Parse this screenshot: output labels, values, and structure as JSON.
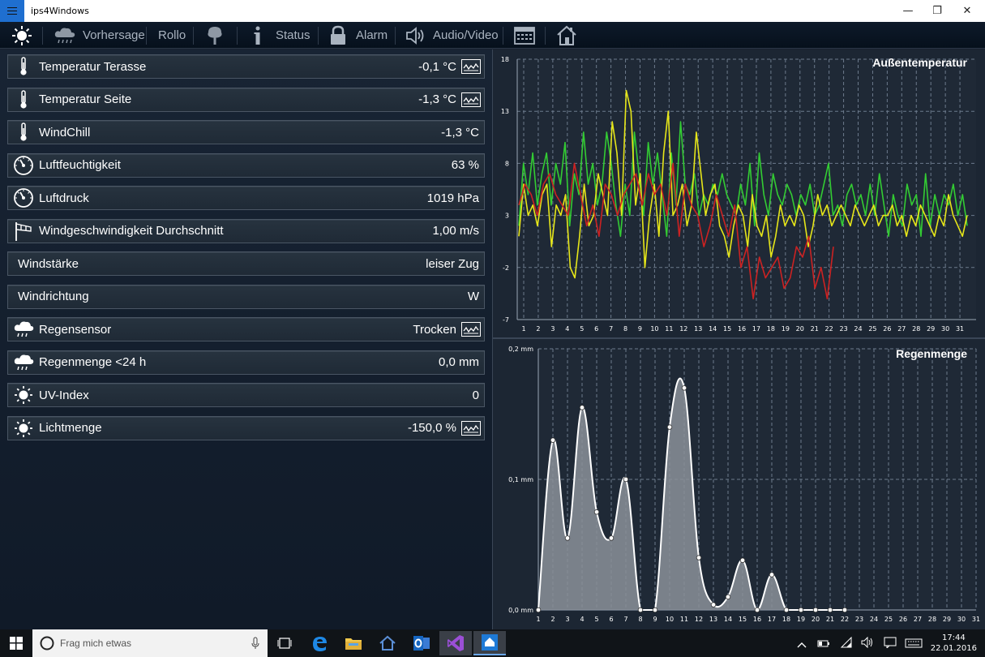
{
  "app": {
    "title": "ips4Windows"
  },
  "window_controls": {
    "minimize": "—",
    "maximize": "❐",
    "close": "✕"
  },
  "nav": {
    "items": [
      {
        "label": ""
      },
      {
        "label": "Vorhersage"
      },
      {
        "label": "Rollo"
      },
      {
        "label": ""
      },
      {
        "label": "Status"
      },
      {
        "label": "Alarm"
      },
      {
        "label": "Audio/Video"
      },
      {
        "label": ""
      },
      {
        "label": ""
      }
    ]
  },
  "sensors": [
    {
      "label": "Temperatur Terasse",
      "value": "-0,1 °C",
      "icon": "thermometer-icon",
      "chart": true
    },
    {
      "label": "Temperatur Seite",
      "value": "-1,3 °C",
      "icon": "thermometer-icon",
      "chart": true
    },
    {
      "label": "WindChill",
      "value": "-1,3 °C",
      "icon": "thermometer-icon",
      "chart": false
    },
    {
      "label": "Luftfeuchtigkeit",
      "value": "63 %",
      "icon": "gauge-icon",
      "chart": false
    },
    {
      "label": "Luftdruck",
      "value": "1019 hPa",
      "icon": "gauge-icon",
      "chart": false
    },
    {
      "label": "Windgeschwindigkeit Durchschnitt",
      "value": "1,00 m/s",
      "icon": "windsock-icon",
      "chart": false
    },
    {
      "label": "Windstärke",
      "value": "leiser Zug",
      "icon": "",
      "chart": false
    },
    {
      "label": "Windrichtung",
      "value": "W",
      "icon": "",
      "chart": false
    },
    {
      "label": "Regensensor",
      "value": "Trocken",
      "icon": "rain-cloud-icon",
      "chart": true
    },
    {
      "label": "Regenmenge <24 h",
      "value": "0,0 mm",
      "icon": "rain-cloud-icon",
      "chart": false
    },
    {
      "label": "UV-Index",
      "value": "0",
      "icon": "sun-icon",
      "chart": false
    },
    {
      "label": "Lichtmenge",
      "value": "-150,0 %",
      "icon": "sun-icon",
      "chart": true
    }
  ],
  "colors": {
    "green": "#33cc33",
    "yellow": "#e6e619",
    "red": "#cc2222",
    "grid": "#6c7a8c",
    "rain_fill": "#8b9099"
  },
  "chart_temp": {
    "type": "line",
    "title": "Außentemperatur",
    "y_ticks": [
      "18",
      "13",
      "8",
      "3",
      "-2",
      "-7"
    ],
    "x_ticks": [
      "1",
      "2",
      "3",
      "4",
      "5",
      "6",
      "7",
      "8",
      "9",
      "10",
      "11",
      "12",
      "13",
      "14",
      "15",
      "16",
      "17",
      "18",
      "19",
      "20",
      "21",
      "22",
      "23",
      "24",
      "25",
      "26",
      "27",
      "28",
      "29",
      "30",
      "31"
    ],
    "ylim": [
      -7,
      18
    ],
    "series": [
      {
        "color": "#33cc33",
        "values": [
          2,
          8,
          5,
          9,
          4,
          7,
          9,
          4,
          8,
          6,
          10,
          2,
          7,
          5,
          11,
          6,
          8,
          4,
          6,
          11,
          8,
          4,
          1,
          6,
          3,
          11,
          7,
          3,
          10,
          6,
          9,
          5,
          1,
          9,
          4,
          12,
          6,
          5,
          7,
          3,
          5,
          4,
          6,
          5,
          7,
          5,
          4,
          3,
          6,
          4,
          8,
          2,
          9,
          5,
          3,
          7,
          5,
          4,
          6,
          5,
          3,
          5,
          4,
          6,
          3,
          4,
          6,
          8,
          3,
          4,
          2,
          5,
          6,
          4,
          5,
          3,
          6,
          3,
          7,
          4,
          1,
          5,
          3,
          2,
          6,
          4,
          5,
          1,
          7,
          2,
          5,
          3,
          5,
          4,
          6,
          3,
          5,
          2
        ]
      },
      {
        "color": "#e6e619",
        "values": [
          1,
          6,
          3,
          4,
          2,
          5,
          6,
          0,
          4,
          3,
          5,
          -2,
          -3,
          1,
          6,
          2,
          3,
          7,
          5,
          3,
          12,
          9,
          3,
          15,
          13,
          4,
          7,
          -2,
          3,
          6,
          1,
          9,
          13,
          3,
          4,
          6,
          2,
          4,
          11,
          7,
          3,
          5,
          6,
          2,
          1,
          -1,
          2,
          4,
          3,
          0,
          5,
          2,
          1,
          3,
          -1,
          1,
          4,
          2,
          3,
          2,
          4,
          3,
          0,
          2,
          5,
          3,
          4,
          2,
          3,
          4,
          3,
          2,
          4,
          3,
          2,
          3,
          4,
          2,
          3,
          3,
          4,
          2,
          3,
          1,
          3,
          2,
          4,
          3,
          2,
          1,
          3,
          2,
          5,
          3,
          2,
          1,
          3
        ]
      },
      {
        "color": "#cc2222",
        "values": [
          4,
          6,
          5,
          3,
          6,
          7,
          5,
          4,
          3,
          8,
          5,
          2,
          4,
          1,
          6,
          5,
          3,
          5,
          6,
          7,
          4,
          7,
          5,
          6,
          3,
          8,
          1,
          6,
          4,
          3,
          0,
          2,
          5,
          3,
          1,
          4,
          -2,
          0,
          -5,
          -1,
          -3,
          -2,
          -1,
          -4,
          -3,
          0,
          -1,
          1,
          -4,
          -2,
          -5,
          0
        ]
      }
    ]
  },
  "chart_rain": {
    "type": "area",
    "title": "Regenmenge",
    "y_ticks": [
      "0,2 mm",
      "0,1 mm",
      "0,0 mm"
    ],
    "x_ticks": [
      "1",
      "2",
      "3",
      "4",
      "5",
      "6",
      "7",
      "8",
      "9",
      "10",
      "11",
      "12",
      "13",
      "14",
      "15",
      "16",
      "17",
      "18",
      "19",
      "20",
      "21",
      "22",
      "23",
      "24",
      "25",
      "26",
      "27",
      "28",
      "29",
      "30",
      "31"
    ],
    "ylim": [
      0,
      0.2
    ],
    "x": [
      1,
      2,
      3,
      4,
      5,
      6,
      7,
      8,
      9,
      10,
      11,
      12,
      13,
      14,
      15,
      16,
      17,
      18,
      19,
      20,
      21,
      22
    ],
    "values": [
      0,
      0.13,
      0.055,
      0.155,
      0.075,
      0.055,
      0.1,
      0,
      0,
      0.14,
      0.17,
      0.04,
      0.004,
      0.01,
      0.038,
      0,
      0.027,
      0,
      0,
      0,
      0,
      0
    ]
  },
  "taskbar": {
    "search_placeholder": "Frag mich etwas",
    "time": "17:44",
    "date": "22.01.2016"
  }
}
